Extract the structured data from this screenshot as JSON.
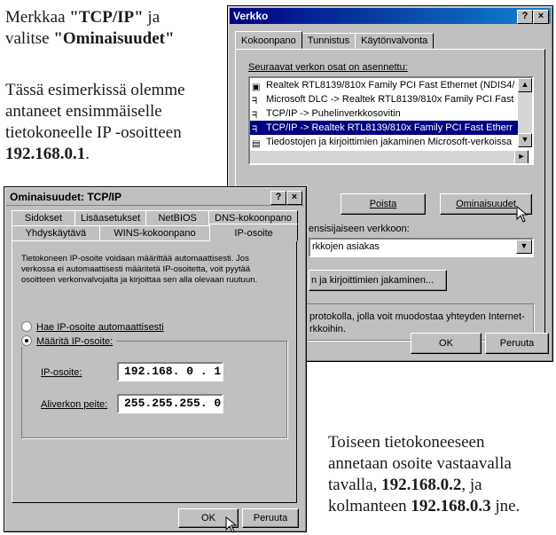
{
  "instructions": {
    "para1_a": "Merkkaa ",
    "para1_b": "\"TCP/IP\"",
    "para1_c": " ja",
    "para1_d": "valitse ",
    "para1_e": "\"Ominaisuudet\"",
    "para2_a": "Tässä esimerkissä olemme",
    "para2_b": "antaneet ensimmäiselle",
    "para2_c": "tietokoneelle IP -osoitteen",
    "para2_d": "192.168.0.1",
    "para2_e": ".",
    "para3_a": "Toiseen tietokoneeseen",
    "para3_b": "annetaan osoite vastaavalla",
    "para3_c": "tavalla, ",
    "para3_d": "192.168.0.2",
    "para3_e": ", ja",
    "para3_f": "kolmanteen ",
    "para3_g": "192.168.0.3",
    "para3_h": " jne."
  },
  "network_dialog": {
    "title": "Verkko",
    "help": "?",
    "close": "×",
    "tabs": [
      "Kokoonpano",
      "Tunnistus",
      "Käytönvalvonta"
    ],
    "list_label": "Seuraavat verkon osat on asennettu:",
    "components": [
      "Realtek RTL8139/810x Family PCI Fast Ethernet (NDIS4/",
      "Microsoft DLC -> Realtek RTL8139/810x Family PCI Fast",
      "TCP/IP -> Puhelinverkkosovitin",
      "TCP/IP -> Realtek RTL8139/810x Family PCI Fast Etherr",
      "Tiedostojen ja kirjoittimien jakaminen Microsoft-verkoissa"
    ],
    "selected_index": 3,
    "btn_remove": "Poista",
    "btn_properties": "Ominaisuudet",
    "primary_logon_label": "ensisijaiseen verkkoon:",
    "primary_logon_value": "rkkojen asiakas",
    "file_sharing_btn": "n ja kirjoittimien jakaminen...",
    "desc_line1": "protokolla, jolla voit muodostaa yhteyden Internet-",
    "desc_line2": "rkkoihin.",
    "ok": "OK",
    "cancel": "Peruuta"
  },
  "tcpip_dialog": {
    "title": "Ominaisuudet: TCP/IP",
    "help": "?",
    "close": "×",
    "tabs_row1": [
      "Sidokset",
      "Lisäasetukset",
      "NetBIOS",
      "DNS-kokoonpano"
    ],
    "tabs_row2": [
      "Yhdyskäytävä",
      "WINS-kokoonpano",
      "IP-osoite"
    ],
    "description": [
      "Tietokoneen IP-osoite voidaan määrittää automaattisesti. Jos",
      "verkossa ei automaattisesti määritetä IP-osoitetta, voit pyytää",
      "osoitteen verkonvalvojalta ja kirjoittaa sen alla olevaan ruutuun."
    ],
    "radio_auto": "Hae IP-osoite automaattisesti",
    "radio_manual": "Määritä IP-osoite:",
    "ip_label": "IP-osoite:",
    "ip_value": "192.168. 0 . 1",
    "mask_label": "Aliverkon peite:",
    "mask_value": "255.255.255. 0",
    "ok": "OK",
    "cancel": "Peruuta"
  }
}
